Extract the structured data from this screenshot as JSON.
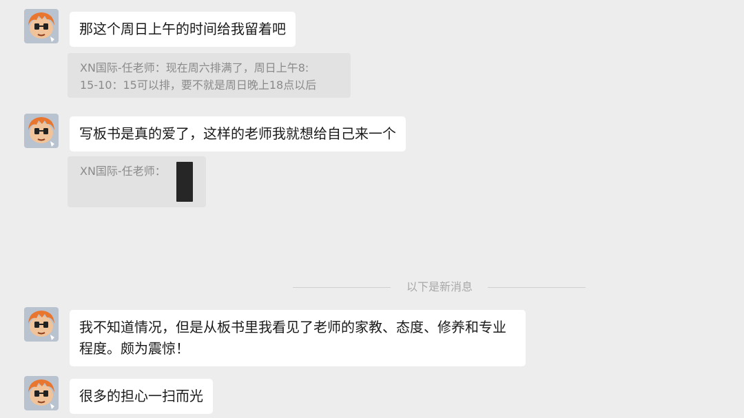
{
  "messages": [
    {
      "text": "那这个周日上午的时间给我留着吧"
    },
    {
      "text": "写板书是真的爱了，这样的老师我就想给自己来一个"
    },
    {
      "text": "我不知道情况，但是从板书里我看见了老师的家教、态度、修养和专业\n程度。颇为震惊！"
    },
    {
      "text": "很多的担心一扫而光"
    }
  ],
  "quotes": [
    {
      "text": "XN国际-任老师：现在周六排满了，周日上午8:\n15-10：15可以排，要不就是周日晚上18点以后"
    },
    {
      "text": "XN国际-任老师："
    }
  ],
  "divider": {
    "label": "以下是新消息"
  },
  "avatar_icon": "cartoon-avatar-icon",
  "colors": {
    "background": "#ededed",
    "bubble": "#ffffff",
    "quote_bg": "#e2e2e2",
    "quote_text": "#8a8a8a",
    "avatar_hair": "#e8762f"
  }
}
